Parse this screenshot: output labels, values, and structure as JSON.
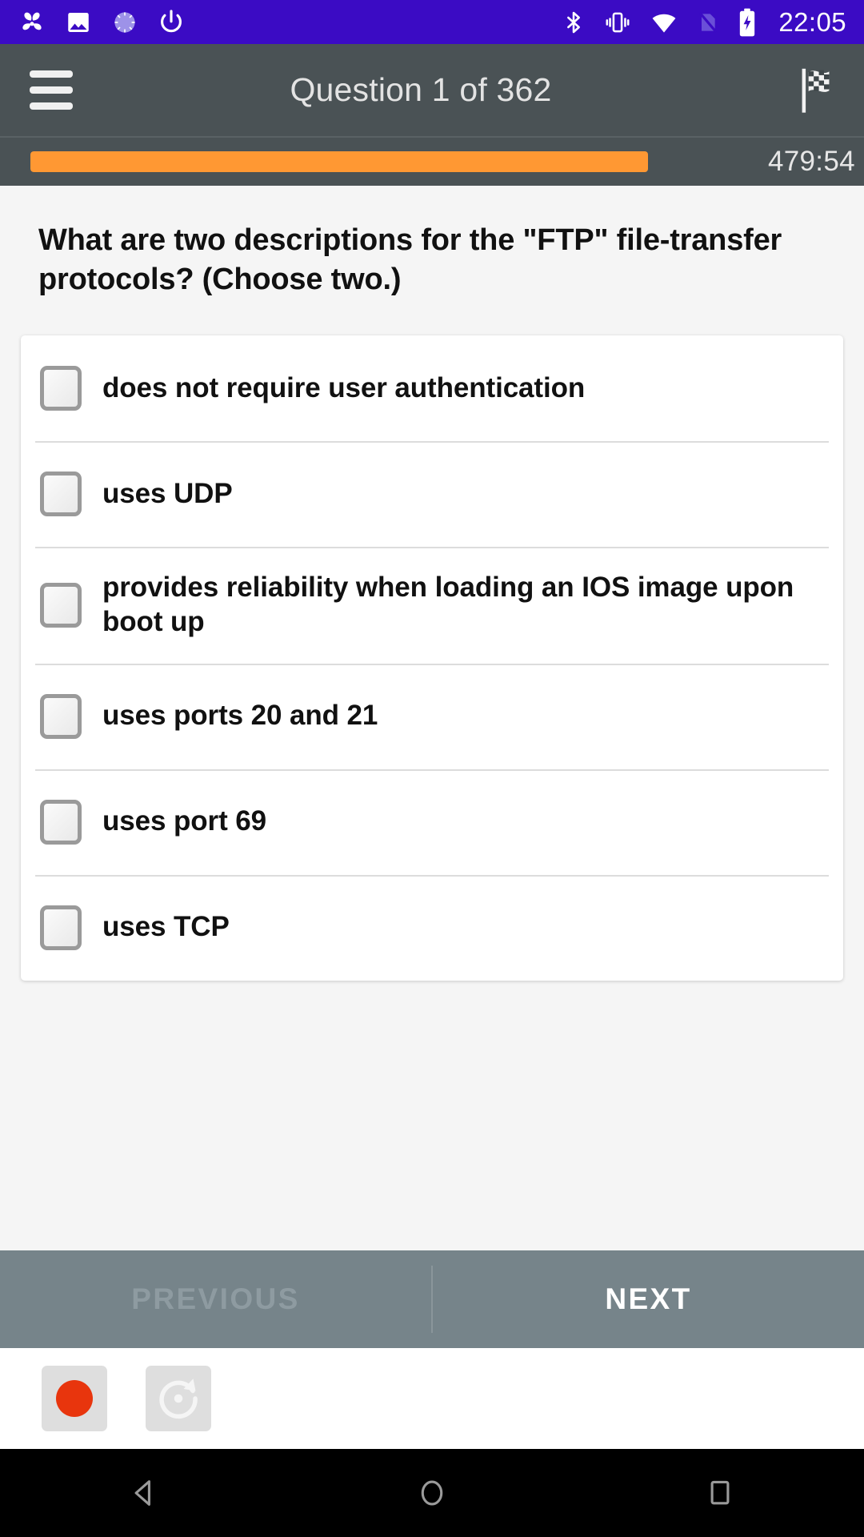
{
  "status_bar": {
    "left_icons": [
      {
        "name": "pinwheel-icon"
      },
      {
        "name": "photo-icon"
      },
      {
        "name": "sync-spinner-icon"
      },
      {
        "name": "power-icon"
      }
    ],
    "right_icons": [
      {
        "name": "bluetooth-icon"
      },
      {
        "name": "vibrate-icon"
      },
      {
        "name": "wifi-icon"
      },
      {
        "name": "sim-off-icon"
      },
      {
        "name": "battery-charging-icon"
      }
    ],
    "clock": "22:05",
    "background_color": "#3B0BC4"
  },
  "app_bar": {
    "menu_icon": "hamburger-menu-icon",
    "title": "Question 1 of 362",
    "flag_icon": "checkered-flag-icon",
    "background_color": "#4A5255"
  },
  "progress": {
    "percent": 86,
    "fill_color": "#FF9833",
    "timer": "479:54"
  },
  "question": {
    "text": "What are two descriptions for the \"FTP\" file-transfer protocols? (Choose two.)"
  },
  "options": [
    {
      "label": "does not require user authentication",
      "checked": false
    },
    {
      "label": "uses UDP",
      "checked": false
    },
    {
      "label": "provides reliability when loading an IOS image upon boot up",
      "checked": false
    },
    {
      "label": "uses ports 20 and 21",
      "checked": false
    },
    {
      "label": "uses port 69",
      "checked": false
    },
    {
      "label": "uses TCP",
      "checked": false
    }
  ],
  "bottom_nav": {
    "previous_label": "PREVIOUS",
    "previous_enabled": false,
    "next_label": "NEXT",
    "next_enabled": true,
    "background_color": "#76848A"
  },
  "recorder_toolbar": {
    "record_button": "record-button",
    "rotate_button": "rotate-refresh-button",
    "record_dot_color": "#E8350D"
  },
  "android_nav": {
    "back": "back-triangle-icon",
    "home": "home-circle-icon",
    "recents": "recents-square-icon"
  }
}
